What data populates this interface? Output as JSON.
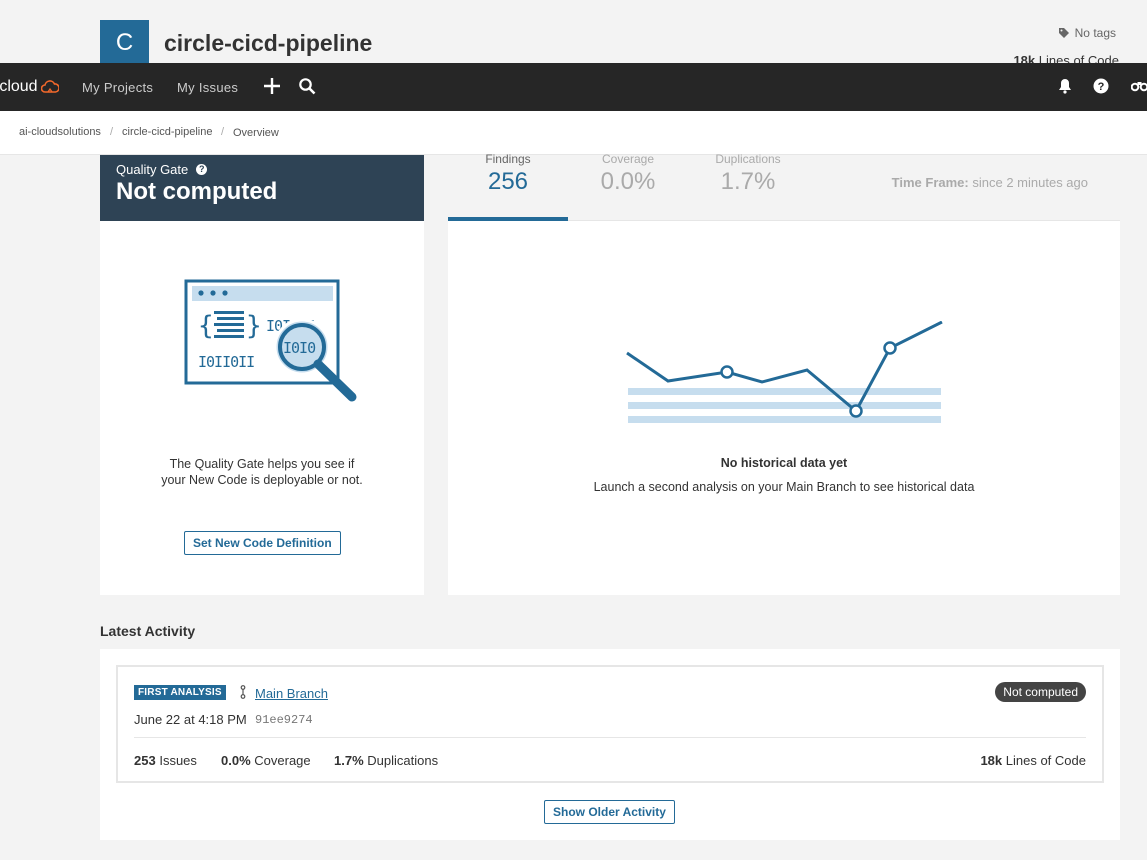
{
  "project": {
    "avatar_letter": "C",
    "name": "circle-cicd-pipeline",
    "tags": "No tags",
    "loc_value": "18k",
    "loc_label": "Lines of Code"
  },
  "navbar": {
    "logo_text": "rcloud",
    "links": [
      "My Projects",
      "My Issues"
    ]
  },
  "breadcrumb": [
    "ai-cloudsolutions",
    "circle-cicd-pipeline",
    "Overview"
  ],
  "quality_gate": {
    "label": "Quality Gate",
    "help": "?",
    "status": "Not computed",
    "text_line1": "The Quality Gate helps you see if",
    "text_line2": "your New Code is deployable or not.",
    "button": "Set New Code Definition"
  },
  "measures": {
    "tabs": [
      {
        "label": "Findings",
        "value": "256"
      },
      {
        "label": "Coverage",
        "value": "0.0%"
      },
      {
        "label": "Duplications",
        "value": "1.7%"
      }
    ],
    "timeframe_label": "Time Frame:",
    "timeframe_value": "since 2 minutes ago",
    "empty_title": "No historical data yet",
    "empty_sub": "Launch a second analysis on your Main Branch to see historical data"
  },
  "activity": {
    "title": "Latest Activity",
    "badge": "FIRST ANALYSIS",
    "branch": "Main Branch",
    "status": "Not computed",
    "date": "June 22 at 4:18 PM",
    "hash": "91ee9274",
    "stats": [
      {
        "value": "253",
        "label": "Issues"
      },
      {
        "value": "0.0%",
        "label": "Coverage"
      },
      {
        "value": "1.7%",
        "label": "Duplications"
      }
    ],
    "loc_value": "18k",
    "loc_label": "Lines of Code",
    "older_button": "Show Older Activity"
  },
  "colors": {
    "accent": "#236a97",
    "navbar": "#262626",
    "quality_gate_header": "#2e4355",
    "logo_cloud": "#f2682b"
  }
}
